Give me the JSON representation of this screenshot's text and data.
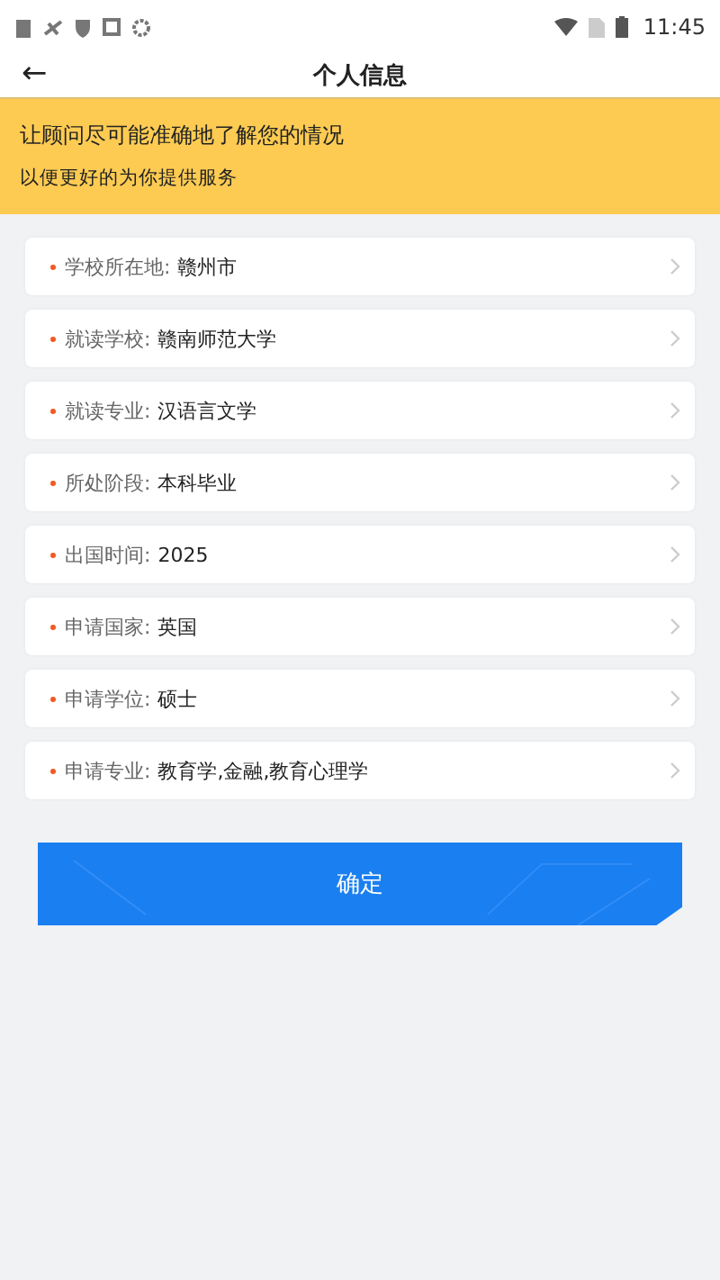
{
  "status_bar": {
    "time": "11:45"
  },
  "header": {
    "title": "个人信息",
    "back": "←"
  },
  "banner": {
    "title": "让顾问尽可能准确地了解您的情况",
    "subtitle": "以便更好的为你提供服务"
  },
  "fields": [
    {
      "required": true,
      "label": "学校所在地:",
      "value": "赣州市"
    },
    {
      "required": true,
      "label": "就读学校:",
      "value": "赣南师范大学"
    },
    {
      "required": true,
      "label": "就读专业:",
      "value": "汉语言文学"
    },
    {
      "required": true,
      "label": "所处阶段:",
      "value": "本科毕业"
    },
    {
      "required": true,
      "label": "出国时间:",
      "value": "2025"
    },
    {
      "required": true,
      "label": "申请国家:",
      "value": "英国"
    },
    {
      "required": true,
      "label": "申请学位:",
      "value": "硕士"
    },
    {
      "required": true,
      "label": "申请专业:",
      "value": "教育学,金融,教育心理学"
    }
  ],
  "submit": "确定"
}
